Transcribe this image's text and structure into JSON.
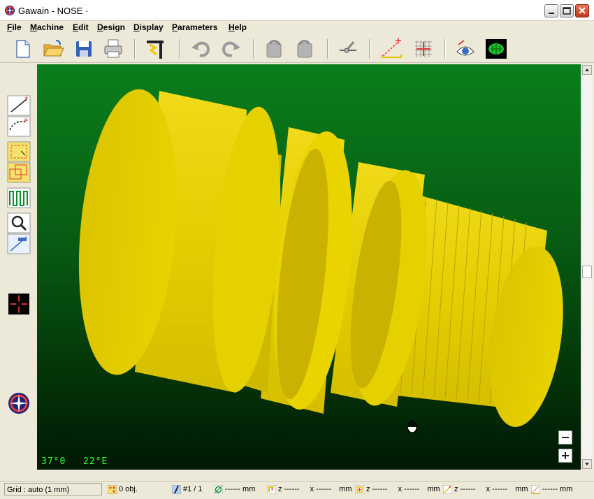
{
  "window": {
    "title": "Gawain  - NOSE  ·"
  },
  "menu": [
    "File",
    "Machine",
    "Edit",
    "Design",
    "Display",
    "Parameters",
    "Help"
  ],
  "toolbar": {
    "icons": [
      "new-file-icon",
      "open-folder-icon",
      "save-icon",
      "print-icon",
      "machine-tool-icon",
      "undo-icon",
      "redo-icon",
      "rotate-left-icon",
      "rotate-right-icon",
      "tool-path-icon",
      "measure-line-icon",
      "grid-target-icon",
      "eye-view-icon",
      "render-3d-icon"
    ]
  },
  "leftbar": {
    "icons": [
      "draw-line-icon",
      "draw-arc-icon",
      "select-region-icon",
      "move-region-icon",
      "profile-icon",
      "zoom-icon",
      "dimension-icon",
      "crosshair-icon",
      "compass-icon"
    ]
  },
  "viewport": {
    "coord_x": "37°0",
    "coord_y": "22°E",
    "cursor_icon": "hand-cursor-icon",
    "zoom_out_icon": "minus-icon",
    "zoom_in_icon": "plus-icon"
  },
  "colors": {
    "part_yellow": "#e3ce00",
    "viewport_green": "#0b7e1c",
    "coord_green": "#31ff31"
  },
  "status": {
    "grid": "Grid : auto  (1 mm)",
    "objects": "0 obj.",
    "tool": "#1 / 1",
    "diameter": "------ mm",
    "p1_z": "z ------",
    "p1_x": "x ------",
    "p1_unit": "mm",
    "p2_z": "z ------",
    "p2_x": "x ------",
    "p2_unit": "mm",
    "p3_z": "z ------",
    "p3_x": "x ------",
    "p3_unit": "mm",
    "length": "------ mm"
  }
}
